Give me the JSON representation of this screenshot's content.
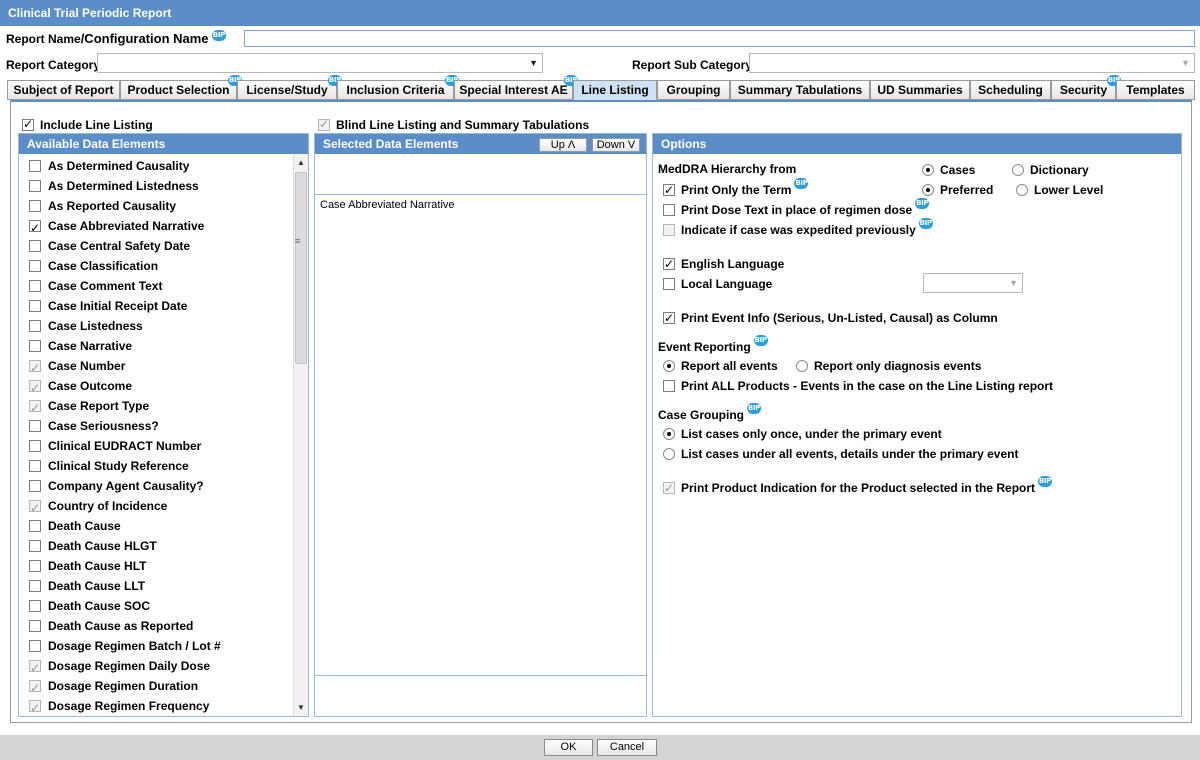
{
  "window": {
    "title": "Clinical Trial Periodic Report"
  },
  "header": {
    "report_name_label": "Report Name",
    "config_name_label": "/Configuration Name",
    "report_category_label": "Report Category",
    "report_sub_category_label": "Report Sub Category"
  },
  "tabs": [
    {
      "label": "Subject of Report",
      "bip": false
    },
    {
      "label": "Product Selection",
      "bip": true
    },
    {
      "label": "License/Study",
      "bip": true
    },
    {
      "label": "Inclusion Criteria",
      "bip": true
    },
    {
      "label": "Special Interest AE",
      "bip": true
    },
    {
      "label": "Line Listing",
      "bip": false,
      "active": true
    },
    {
      "label": "Grouping",
      "bip": false
    },
    {
      "label": "Summary Tabulations",
      "bip": false
    },
    {
      "label": "UD Summaries",
      "bip": false
    },
    {
      "label": "Scheduling",
      "bip": false
    },
    {
      "label": "Security",
      "bip": true
    },
    {
      "label": "Templates",
      "bip": false
    }
  ],
  "bip_icon_text": "BIP",
  "include_line_listing": {
    "label": "Include Line Listing",
    "checked": true
  },
  "blind_line_listing": {
    "label": "Blind Line Listing and Summary Tabulations",
    "checked": true,
    "disabled": true
  },
  "available": {
    "title": "Available Data Elements",
    "items": [
      {
        "label": "As Determined Causality",
        "state": "off"
      },
      {
        "label": "As Determined Listedness",
        "state": "off"
      },
      {
        "label": "As Reported Causality",
        "state": "off"
      },
      {
        "label": "Case Abbreviated Narrative",
        "state": "on"
      },
      {
        "label": "Case Central Safety Date",
        "state": "off"
      },
      {
        "label": "Case Classification",
        "state": "off"
      },
      {
        "label": "Case Comment Text",
        "state": "off"
      },
      {
        "label": "Case Initial Receipt Date",
        "state": "off"
      },
      {
        "label": "Case Listedness",
        "state": "off"
      },
      {
        "label": "Case Narrative",
        "state": "off"
      },
      {
        "label": "Case Number",
        "state": "dis-on"
      },
      {
        "label": "Case Outcome",
        "state": "dis-on"
      },
      {
        "label": "Case Report Type",
        "state": "dis-on"
      },
      {
        "label": "Case Seriousness?",
        "state": "off"
      },
      {
        "label": "Clinical EUDRACT Number",
        "state": "off"
      },
      {
        "label": "Clinical Study Reference",
        "state": "off"
      },
      {
        "label": "Company Agent Causality?",
        "state": "off"
      },
      {
        "label": "Country of Incidence",
        "state": "dis-on"
      },
      {
        "label": "Death Cause",
        "state": "off"
      },
      {
        "label": "Death Cause HLGT",
        "state": "off"
      },
      {
        "label": "Death Cause HLT",
        "state": "off"
      },
      {
        "label": "Death Cause LLT",
        "state": "off"
      },
      {
        "label": "Death Cause SOC",
        "state": "off"
      },
      {
        "label": "Death Cause as Reported",
        "state": "off"
      },
      {
        "label": "Dosage Regimen Batch / Lot #",
        "state": "off"
      },
      {
        "label": "Dosage Regimen Daily Dose",
        "state": "dis-on"
      },
      {
        "label": "Dosage Regimen Duration",
        "state": "dis-on"
      },
      {
        "label": "Dosage Regimen Frequency",
        "state": "dis-on"
      }
    ]
  },
  "selected": {
    "title": "Selected Data Elements",
    "up_label": "Up Λ",
    "down_label": "Down V",
    "items": [
      "Case Abbreviated Narrative"
    ]
  },
  "options": {
    "title": "Options",
    "meddra_label": "MedDRA Hierarchy from",
    "meddra_cases": "Cases",
    "meddra_dictionary": "Dictionary",
    "meddra_preferred": "Preferred",
    "meddra_lower": "Lower Level",
    "print_only_term": "Print Only the Term",
    "print_dose_text": "Print Dose Text in place of regimen dose",
    "indicate_expedited": "Indicate if case was expedited previously",
    "english_language": "English Language",
    "local_language": "Local Language",
    "print_event_info": "Print Event Info (Serious, Un-Listed, Causal) as Column",
    "event_reporting_label": "Event Reporting",
    "report_all_events": "Report all events",
    "report_only_diagnosis": "Report only diagnosis events",
    "print_all_products": "Print ALL Products - Events in the case on the Line Listing report",
    "case_grouping_label": "Case Grouping",
    "list_once": "List cases only once, under the primary event",
    "list_all": "List cases under all events, details under the primary event",
    "print_product_indication": "Print Product Indication for the Product selected in the Report"
  },
  "footer": {
    "ok_label": "OK",
    "cancel_label": "Cancel"
  }
}
